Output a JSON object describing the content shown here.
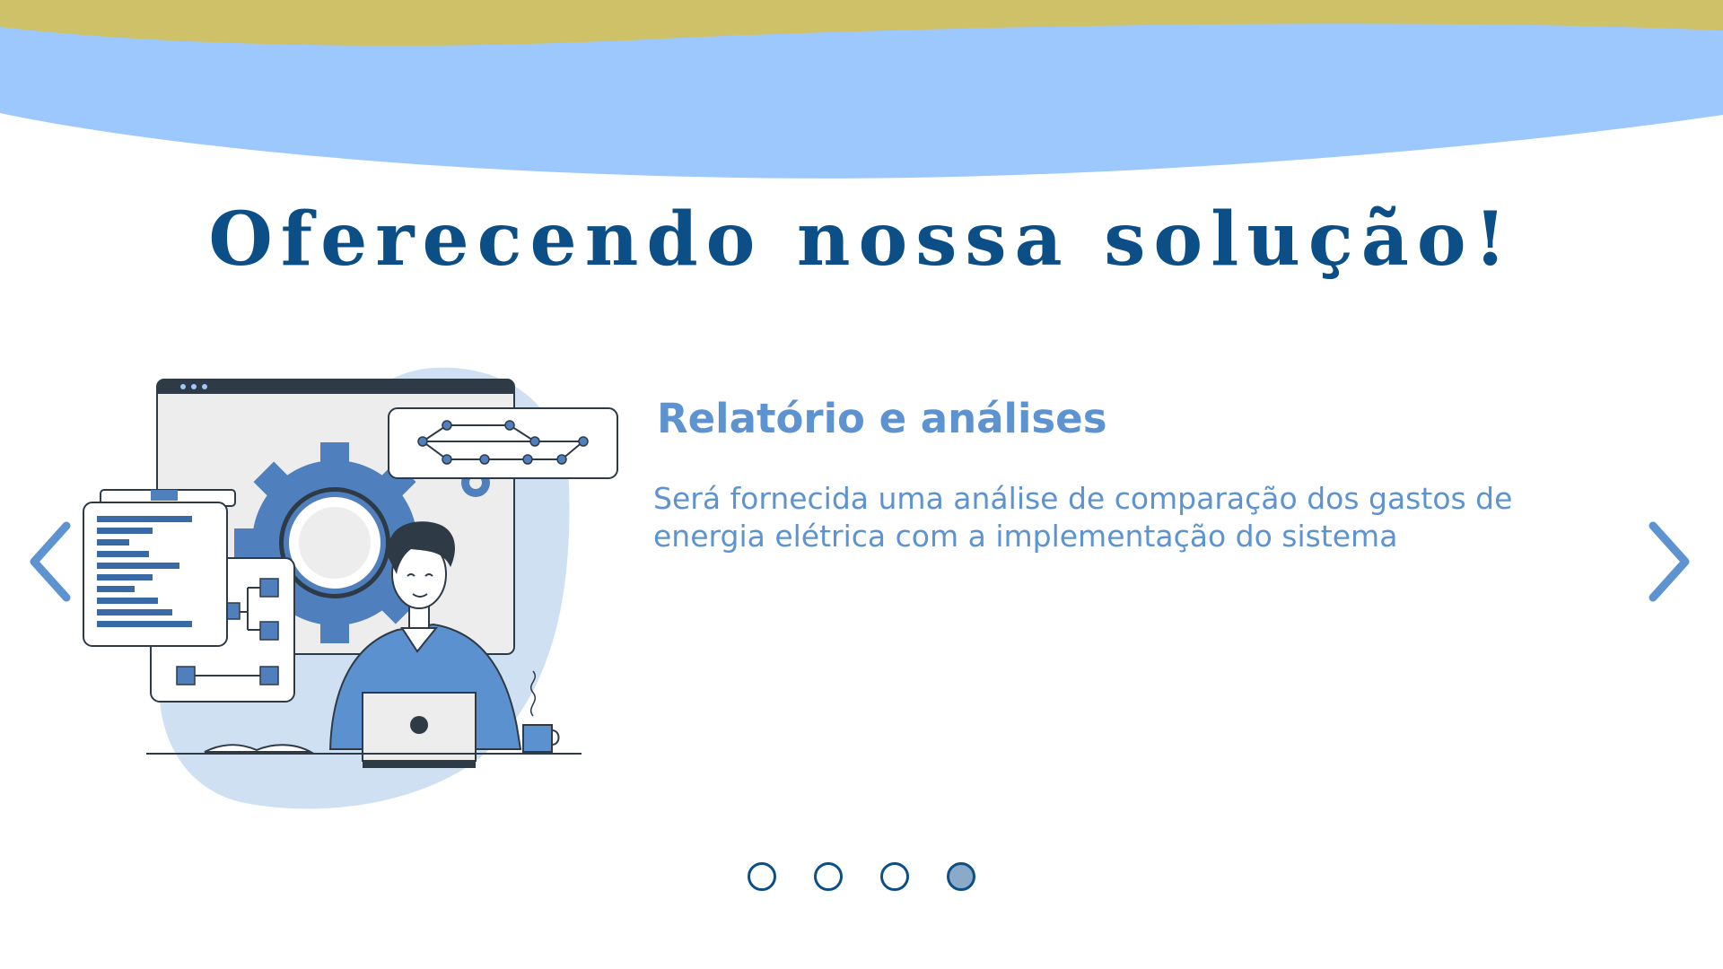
{
  "page": {
    "title": "Oferecendo nossa solução!"
  },
  "slide": {
    "heading": "Relatório e análises",
    "description": "Será fornecida uma análise de comparação dos gastos de energia elétrica com a implementação do sistema"
  },
  "carousel": {
    "prev_icon": "chevron-left-icon",
    "next_icon": "chevron-right-icon",
    "slide_count": 4,
    "active_index": 3
  },
  "colors": {
    "top_band_gold": "#cfc167",
    "top_band_blue": "#9dc8fd",
    "title": "#0c4f86",
    "accent": "#5d93d0",
    "dot_active": "#8ba9c9"
  }
}
